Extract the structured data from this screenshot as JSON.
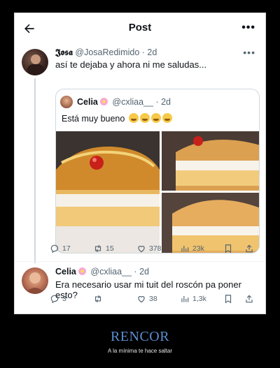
{
  "header": {
    "title": "Post"
  },
  "main_tweet": {
    "name": "𝕵𝖔𝖘𝖆",
    "handle": "@JosaRedimido",
    "time": "2d",
    "text": "así te dejaba y ahora ni me saludas..."
  },
  "quoted_tweet": {
    "name": "Celia",
    "handle": "@cxliaa__",
    "time": "2d",
    "text": "Está muy bueno"
  },
  "main_actions": {
    "replies": "17",
    "reposts": "15",
    "likes": "378",
    "views": "23k"
  },
  "reply_tweet": {
    "name": "Celia",
    "handle": "@cxliaa__",
    "time": "2d",
    "text": "Era necesario usar mi tuit del roscón pa poner esto?"
  },
  "reply_actions": {
    "replies": "3",
    "reposts": "",
    "likes": "38",
    "views": "1,3k"
  },
  "caption": {
    "title": "RENCOR",
    "subtitle": "A la mínima te hace saltar"
  },
  "colors": {
    "accent": "#5b8fd1",
    "muted": "#536471"
  }
}
